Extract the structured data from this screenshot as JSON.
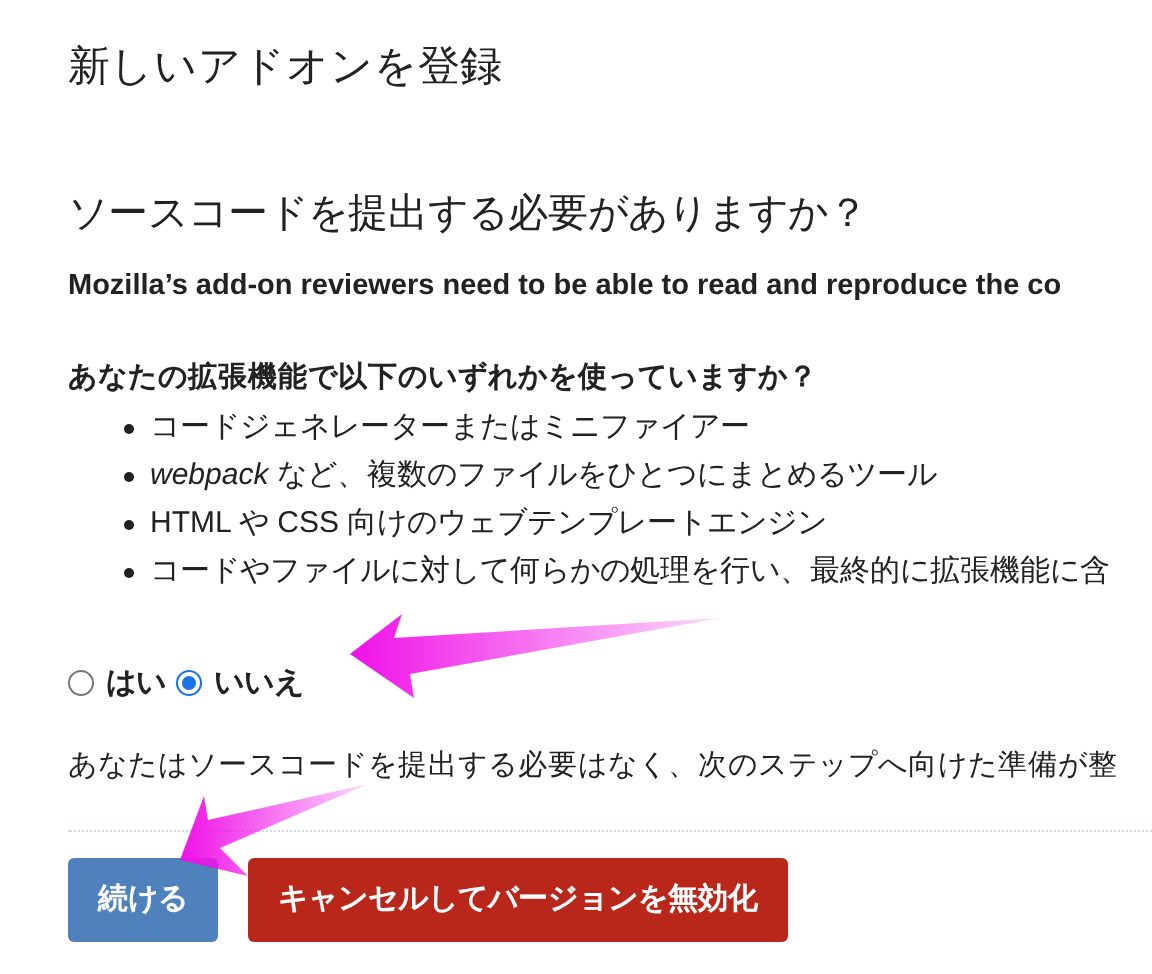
{
  "page_title": "新しいアドオンを登録",
  "section_heading": "ソースコードを提出する必要がありますか？",
  "intro": "Mozilla’s add-on reviewers need to be able to read and reproduce the co",
  "question": "あなたの拡張機能で以下のいずれかを使っていますか？",
  "bullets": [
    {
      "text": "コードジェネレーターまたはミニファイアー"
    },
    {
      "text": "*webpack* など、複数のファイルをひとつにまとめるツール"
    },
    {
      "text": "HTML や CSS 向けのウェブテンプレートエンジン"
    },
    {
      "text": "コードやファイルに対して何らかの処理を行い、最終的に拡張機能に含"
    }
  ],
  "options": [
    {
      "label": "はい",
      "selected": false
    },
    {
      "label": "いいえ",
      "selected": true
    }
  ],
  "note": "あなたはソースコードを提出する必要はなく、次のステップへ向けた準備が整",
  "buttons": [
    {
      "label": "続ける",
      "kind": "primary"
    },
    {
      "label": "キャンセルしてバージョンを無効化",
      "kind": "danger"
    }
  ]
}
